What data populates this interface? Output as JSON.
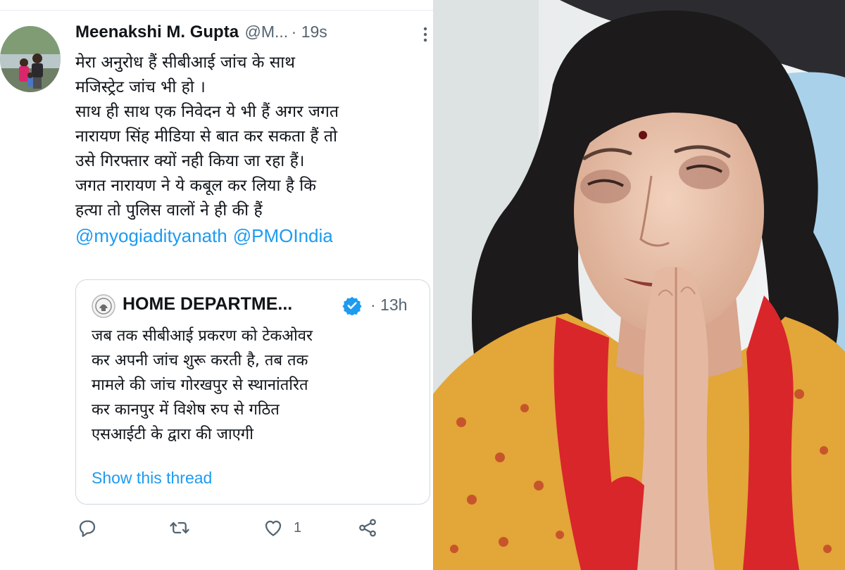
{
  "tweet": {
    "display_name": "Meenakshi M. Gupta",
    "handle": "@M...",
    "time": "· 19s",
    "avatar_icon": "profile-photo-family",
    "more_icon": "more-options-icon",
    "lines": [
      "मेरा अनुरोध हैं सीबीआई जांच के साथ",
      "मजिस्ट्रेट जांच भी हो ।",
      "साथ ही साथ एक निवेदन ये भी हैं अगर जगत",
      "नारायण सिंह मीडिया से बात कर सकता हैं तो",
      "उसे गिरफ्तार क्यों नही किया जा रहा हैं।",
      "जगत नारायण ने ये कबूल कर लिया है कि",
      "हत्या तो पुलिस वालों ने ही की हैं"
    ],
    "mentions": [
      "@myogiadityanath",
      "@PMOIndia"
    ]
  },
  "quote": {
    "name": "HOME DEPARTME...",
    "time": "· 13h",
    "verified_icon": "verified-badge-icon",
    "lines": [
      "जब तक सीबीआई प्रकरण को टेकओवर",
      "कर अपनी जांच शुरू करती है, तब तक",
      "मामले की जांच गोरखपुर से स्थानांतरित",
      "कर कानपुर में विशेष रुप से गठित",
      "एसआईटी के द्वारा की जाएगी"
    ],
    "show_thread": "Show this thread"
  },
  "actions": {
    "reply_icon": "reply-icon",
    "retweet_icon": "retweet-icon",
    "like_icon": "heart-icon",
    "like_count": "1",
    "share_icon": "share-icon"
  },
  "colors": {
    "link": "#1d9bf0",
    "text": "#0f1419",
    "muted": "#536471",
    "border": "#cfd9de"
  }
}
